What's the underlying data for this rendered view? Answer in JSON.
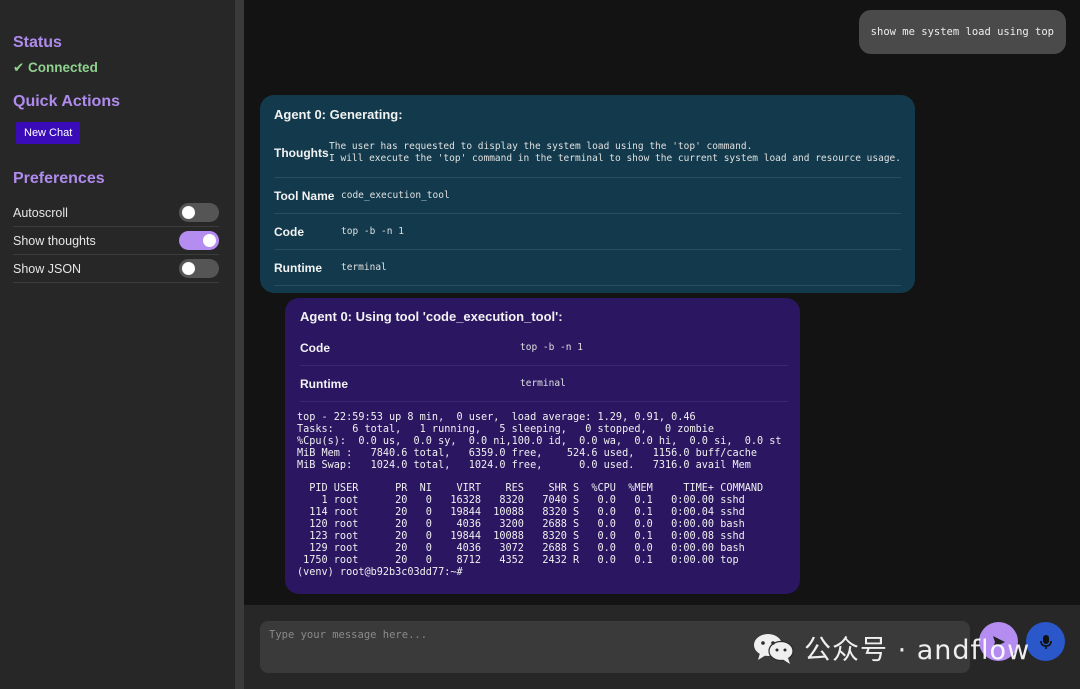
{
  "sidebar": {
    "status_heading": "Status",
    "status_value": "✔ Connected",
    "quick_actions_heading": "Quick Actions",
    "new_chat_label": "New Chat",
    "preferences_heading": "Preferences",
    "preferences": [
      {
        "label": "Autoscroll",
        "enabled": false
      },
      {
        "label": "Show thoughts",
        "enabled": true
      },
      {
        "label": "Show JSON",
        "enabled": false
      }
    ]
  },
  "chat": {
    "user_message": "show me system load using top",
    "generating_card": {
      "title": "Agent 0: Generating:",
      "rows": [
        {
          "key": "Thoughts",
          "value": "The user has requested to display the system load using the 'top' command.\nI will execute the 'top' command in the terminal to show the current system load and resource usage."
        },
        {
          "key": "Tool Name",
          "value": "code_execution_tool"
        },
        {
          "key": "Code",
          "value": "top -b -n 1"
        },
        {
          "key": "Runtime",
          "value": "terminal"
        }
      ]
    },
    "tool_card": {
      "title": "Agent 0: Using tool 'code_execution_tool':",
      "rows": [
        {
          "key": "Code",
          "value": "top -b -n 1"
        },
        {
          "key": "Runtime",
          "value": "terminal"
        }
      ],
      "terminal_output": "top - 22:59:53 up 8 min,  0 user,  load average: 1.29, 0.91, 0.46\nTasks:   6 total,   1 running,   5 sleeping,   0 stopped,   0 zombie\n%Cpu(s):  0.0 us,  0.0 sy,  0.0 ni,100.0 id,  0.0 wa,  0.0 hi,  0.0 si,  0.0 st\nMiB Mem :   7840.6 total,   6359.0 free,    524.6 used,   1156.0 buff/cache\nMiB Swap:   1024.0 total,   1024.0 free,      0.0 used.   7316.0 avail Mem\n\n  PID USER      PR  NI    VIRT    RES    SHR S  %CPU  %MEM     TIME+ COMMAND\n    1 root      20   0   16328   8320   7040 S   0.0   0.1   0:00.00 sshd\n  114 root      20   0   19844  10088   8320 S   0.0   0.1   0:00.04 sshd\n  120 root      20   0    4036   3200   2688 S   0.0   0.0   0:00.00 bash\n  123 root      20   0   19844  10088   8320 S   0.0   0.1   0:00.08 sshd\n  129 root      20   0    4036   3072   2688 S   0.0   0.0   0:00.00 bash\n 1750 root      20   0    8712   4352   2432 R   0.0   0.1   0:00.00 top\n(venv) root@b92b3c03dd77:~#"
    }
  },
  "input": {
    "placeholder": "Type your message here..."
  },
  "watermark": {
    "text": "公众号 · andflow"
  },
  "colors": {
    "accent": "#b58df0",
    "generating_card_bg": "#123a4c",
    "tool_card_bg": "#2a1661",
    "new_chat_bg": "#3a0bb8",
    "connected": "#8fd28f"
  }
}
